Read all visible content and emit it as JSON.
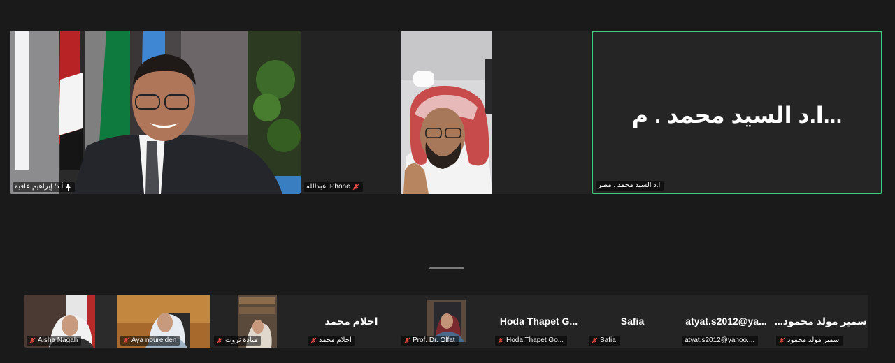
{
  "main_tiles": [
    {
      "name": "أ.د/ إبراهيم عافية",
      "pinned": true,
      "muted": false
    },
    {
      "name": "iPhone عبدالله",
      "muted": true
    },
    {
      "name": "ا.د السيد محمد . مصر",
      "big_label": "...ا.د السيد محمد . م",
      "active": true,
      "muted": false
    }
  ],
  "strip": [
    {
      "name": "Aisha Nagah",
      "muted": true
    },
    {
      "name": "Aya nourelden",
      "muted": true
    },
    {
      "name": "ميادة ثروت",
      "muted": true
    },
    {
      "name": "احلام محمد",
      "big_label": "احلام محمد",
      "muted": true
    },
    {
      "name": "Prof. Dr. Olfat",
      "muted": true
    },
    {
      "name": "Hoda Thapet Go...",
      "big_label": "Hoda Thapet G...",
      "muted": true
    },
    {
      "name": "Safia",
      "big_label": "Safia",
      "muted": true
    },
    {
      "name": "atyat.s2012@yahoo....",
      "big_label": "atyat.s2012@ya...",
      "muted": false
    },
    {
      "name": "سمير مولد محمود",
      "big_label": "سمير مولد محمود...",
      "muted": true
    }
  ],
  "colors": {
    "active_border": "#3ad07f",
    "mute_red": "#e0463c",
    "bg": "#1a1a1a"
  }
}
